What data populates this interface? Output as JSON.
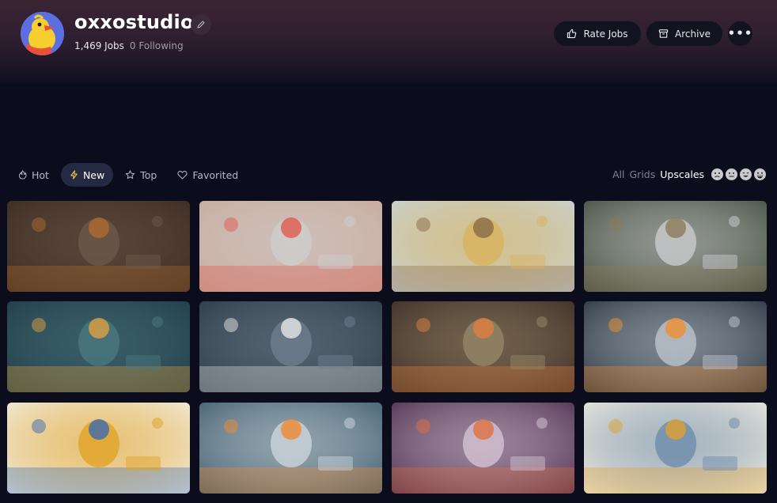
{
  "profile": {
    "username": "oxxostudio",
    "jobs": "1,469 Jobs",
    "following": "0 Following",
    "avatar_icon": "duck-avatar",
    "edit_icon": "pencil-icon"
  },
  "header_actions": {
    "rate_label": "Rate Jobs",
    "rate_icon": "thumbs-up-icon",
    "archive_label": "Archive",
    "archive_icon": "archive-box-icon",
    "more_label": "•••"
  },
  "tabs": [
    {
      "label": "Hot",
      "icon": "fire-icon",
      "active": false
    },
    {
      "label": "New",
      "icon": "lightning-icon",
      "active": true
    },
    {
      "label": "Top",
      "icon": "star-icon",
      "active": false
    },
    {
      "label": "Favorited",
      "icon": "heart-icon",
      "active": false
    }
  ],
  "filters": [
    {
      "label": "All",
      "active": false
    },
    {
      "label": "Grids",
      "active": false
    },
    {
      "label": "Upscales",
      "active": true
    }
  ],
  "rating_icons": [
    "frown-face-icon",
    "meh-face-icon",
    "smile-face-icon",
    "grin-face-icon"
  ],
  "colors": {
    "background": "#0b0d1c",
    "header_gradient_top": "#3a2434",
    "active_tab": "#232a42",
    "button_bg": "#121321",
    "lightning": "#f2c94c"
  },
  "gallery": [
    {
      "name": "robot-army-workshop",
      "bg": "#3b2a22",
      "accent": "#b06a2c",
      "fg": "#6d5a4c"
    },
    {
      "name": "robot-painter-studio",
      "bg": "#c9a99a",
      "accent": "#e05a4f",
      "fg": "#cfcfcf"
    },
    {
      "name": "two-robots-desk",
      "bg": "#c9d2d4",
      "accent": "#8a6a4a",
      "fg": "#d9b25a"
    },
    {
      "name": "man-laptop-forest",
      "bg": "#3e4a3a",
      "accent": "#8a7a5a",
      "fg": "#cfcfd2"
    },
    {
      "name": "boy-night-creatures",
      "bg": "#1f3a44",
      "accent": "#e0a040",
      "fg": "#4d7a80"
    },
    {
      "name": "scientist-chalkboard",
      "bg": "#2a3a44",
      "accent": "#e6e6e6",
      "fg": "#708090"
    },
    {
      "name": "robot-library-reading",
      "bg": "#3a2a24",
      "accent": "#e08040",
      "fg": "#9a8a6a"
    },
    {
      "name": "woman-exploding-head",
      "bg": "#24303c",
      "accent": "#f09030",
      "fg": "#c0c8d0"
    },
    {
      "name": "brain-circuit-diagram",
      "bg": "#f2efe6",
      "accent": "#3a6ab0",
      "fg": "#e0a020"
    },
    {
      "name": "woman-particle-burst",
      "bg": "#3c5a6a",
      "accent": "#f08a30",
      "fg": "#d0d8e0"
    },
    {
      "name": "cute-robot-reading",
      "bg": "#4a2a4a",
      "accent": "#e07040",
      "fg": "#d8c8d8"
    },
    {
      "name": "boy-robot-pile",
      "bg": "#f2ece0",
      "accent": "#e0a030",
      "fg": "#6a8aa8"
    }
  ]
}
